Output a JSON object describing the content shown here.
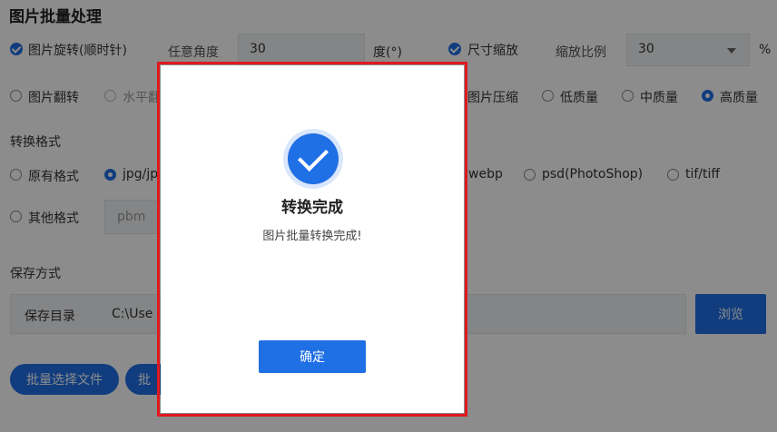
{
  "page": {
    "title": "图片批量处理"
  },
  "row1": {
    "rotate_label": "图片旋转(顺时针)",
    "angle_label": "任意角度",
    "angle_value": "30",
    "degree_unit": "度(°)",
    "resize_label": "尺寸缩放",
    "scale_label": "缩放比例",
    "scale_value": "30",
    "percent_unit": "%"
  },
  "row2": {
    "flip_label": "图片翻转",
    "horizontal_label": "水平翻",
    "compress_label": "图片压缩",
    "low_quality": "低质量",
    "mid_quality": "中质量",
    "high_quality": "高质量"
  },
  "format": {
    "section_label": "转换格式",
    "original": "原有格式",
    "jpg": "jpg/jp",
    "webp": "webp",
    "psd": "psd(PhotoShop)",
    "tif": "tif/tiff",
    "other": "其他格式",
    "other_placeholder": "pbm"
  },
  "save": {
    "section_label": "保存方式",
    "dir_label": "保存目录",
    "dir_value": "C:\\Use",
    "browse_label": "浏览"
  },
  "actions": {
    "batch_select_label": "批量选择文件",
    "second_label": "批"
  },
  "dialog": {
    "title": "转换完成",
    "message": "图片批量转换完成!",
    "confirm_label": "确定"
  }
}
